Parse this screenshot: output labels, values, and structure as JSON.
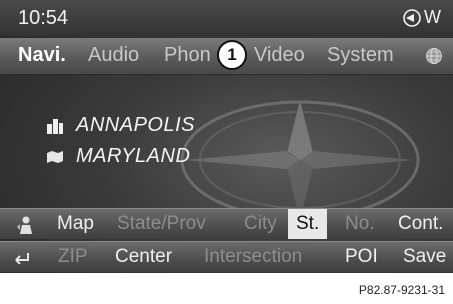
{
  "status": {
    "time": "10:54",
    "right_label": "W"
  },
  "main_menu": {
    "items": [
      {
        "label": "Navi."
      },
      {
        "label": "Audio"
      },
      {
        "label": "Phon"
      },
      {
        "label": "Video"
      },
      {
        "label": "System"
      }
    ]
  },
  "callout": "1",
  "location": {
    "city": "ANNAPOLIS",
    "state": "MARYLAND"
  },
  "address_menu": {
    "map": "Map",
    "state_prov": "State/Prov",
    "city": "City",
    "street": "St.",
    "number": "No.",
    "cont": "Cont."
  },
  "action_menu": {
    "zip": "ZIP",
    "center": "Center",
    "intersection": "Intersection",
    "poi": "POI",
    "save": "Save"
  },
  "reference": "P82.87-9231-31",
  "colors": {
    "selected_bg": "#e8e8e8",
    "dim_text": "#8d8d8d",
    "active_text": "#ffffff"
  }
}
